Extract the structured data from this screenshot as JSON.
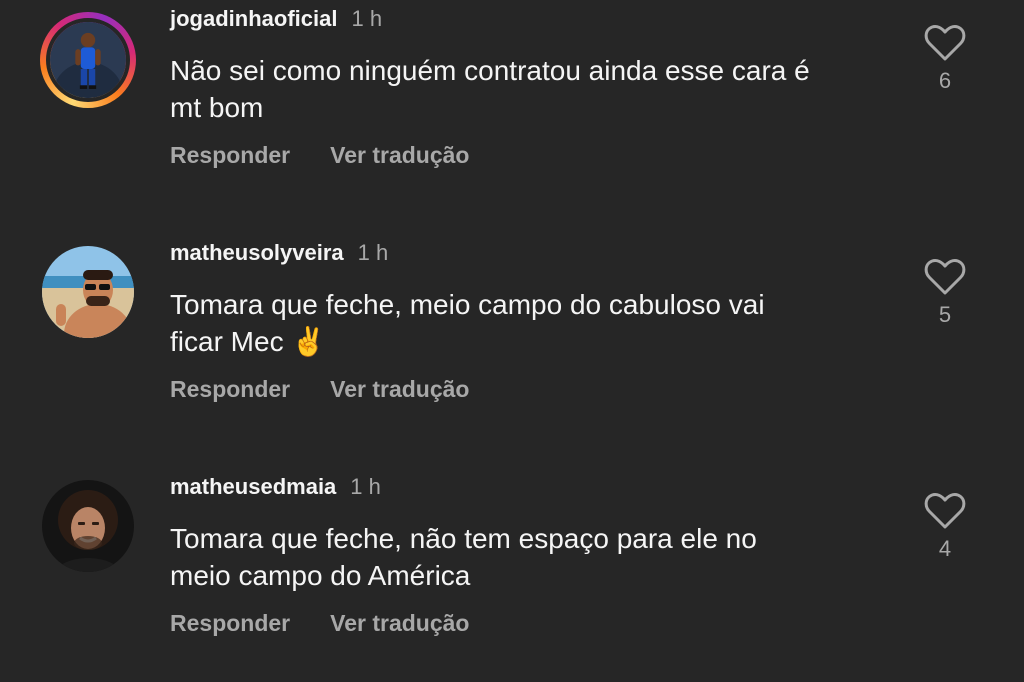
{
  "comments": [
    {
      "username": "jogadinhaoficial",
      "time": "1 h",
      "text_line1": "Não sei como ninguém contratou ainda esse cara é",
      "text_line2": "mt bom",
      "reply_label": "Responder",
      "translate_label": "Ver tradução",
      "likes": "6",
      "avatar_story_ring": true
    },
    {
      "username": "matheusolyveira",
      "time": "1 h",
      "text_line1": "Tomara que feche, meio campo do cabuloso vai",
      "text_line2": "ficar Mec ✌️",
      "reply_label": "Responder",
      "translate_label": "Ver tradução",
      "likes": "5",
      "avatar_story_ring": false
    },
    {
      "username": "matheusedmaia",
      "time": "1 h",
      "text_line1": "Tomara que feche, não tem espaço para ele no",
      "text_line2": "meio campo do América",
      "reply_label": "Responder",
      "translate_label": "Ver tradução",
      "likes": "4",
      "avatar_story_ring": false
    }
  ],
  "colors": {
    "background": "#262626",
    "primary_text": "#f5f5f5",
    "secondary_text": "#a8a8a8"
  },
  "icons": {
    "like": "heart-outline-icon"
  }
}
